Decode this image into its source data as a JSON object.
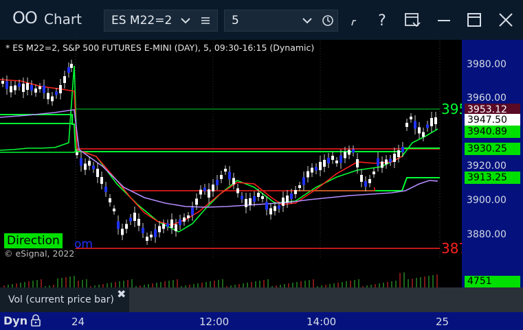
{
  "window": {
    "app_title": "Chart",
    "app_icon": "oo-icon",
    "symbol": "ES M22=2",
    "interval": "5",
    "icons": [
      "draw-icon",
      "help-icon",
      "template-icon",
      "minimize-icon",
      "maximize-icon",
      "close-icon"
    ]
  },
  "chart": {
    "title": "* ES M22=2, S&P 500 FUTURES E-MINI (DAY), 5, 09:30-16:15 (Dynamic)",
    "y_ticks": [
      "3980.00",
      "3960.00",
      "3920.00",
      "3900.00",
      "3880.00"
    ],
    "price_tags": [
      {
        "text": "3953.12",
        "bg": "#5a0a26",
        "fg": "#ffffff"
      },
      {
        "text": "3947.50",
        "bg": "#ffffff",
        "fg": "#000000"
      },
      {
        "text": "3940.89",
        "bg": "#00e000",
        "fg": "#000000"
      },
      {
        "text": "3930.25",
        "bg": "#00e000",
        "fg": "#000000"
      },
      {
        "text": "3913.25",
        "bg": "#00e000",
        "fg": "#000000"
      }
    ],
    "edge_label_top": "395",
    "edge_label_bottom": "387",
    "direction_label": "Direction",
    "overlay_text": "om",
    "copyright": "© eSignal, 2022",
    "colors": {
      "up_candle": "#ffffff",
      "down_candle": "#1f33ff",
      "green_line": "#00ff33",
      "red_line": "#ff2020",
      "purple_line": "#b58cff",
      "axis_bg": "#05127e"
    }
  },
  "volume": {
    "legend": "Vol (current price bar)",
    "close_glyph": "✖",
    "value": "4751"
  },
  "time_axis": {
    "mode": "Dyn",
    "labels": [
      "24",
      "12:00",
      "14:00",
      "25"
    ]
  }
}
